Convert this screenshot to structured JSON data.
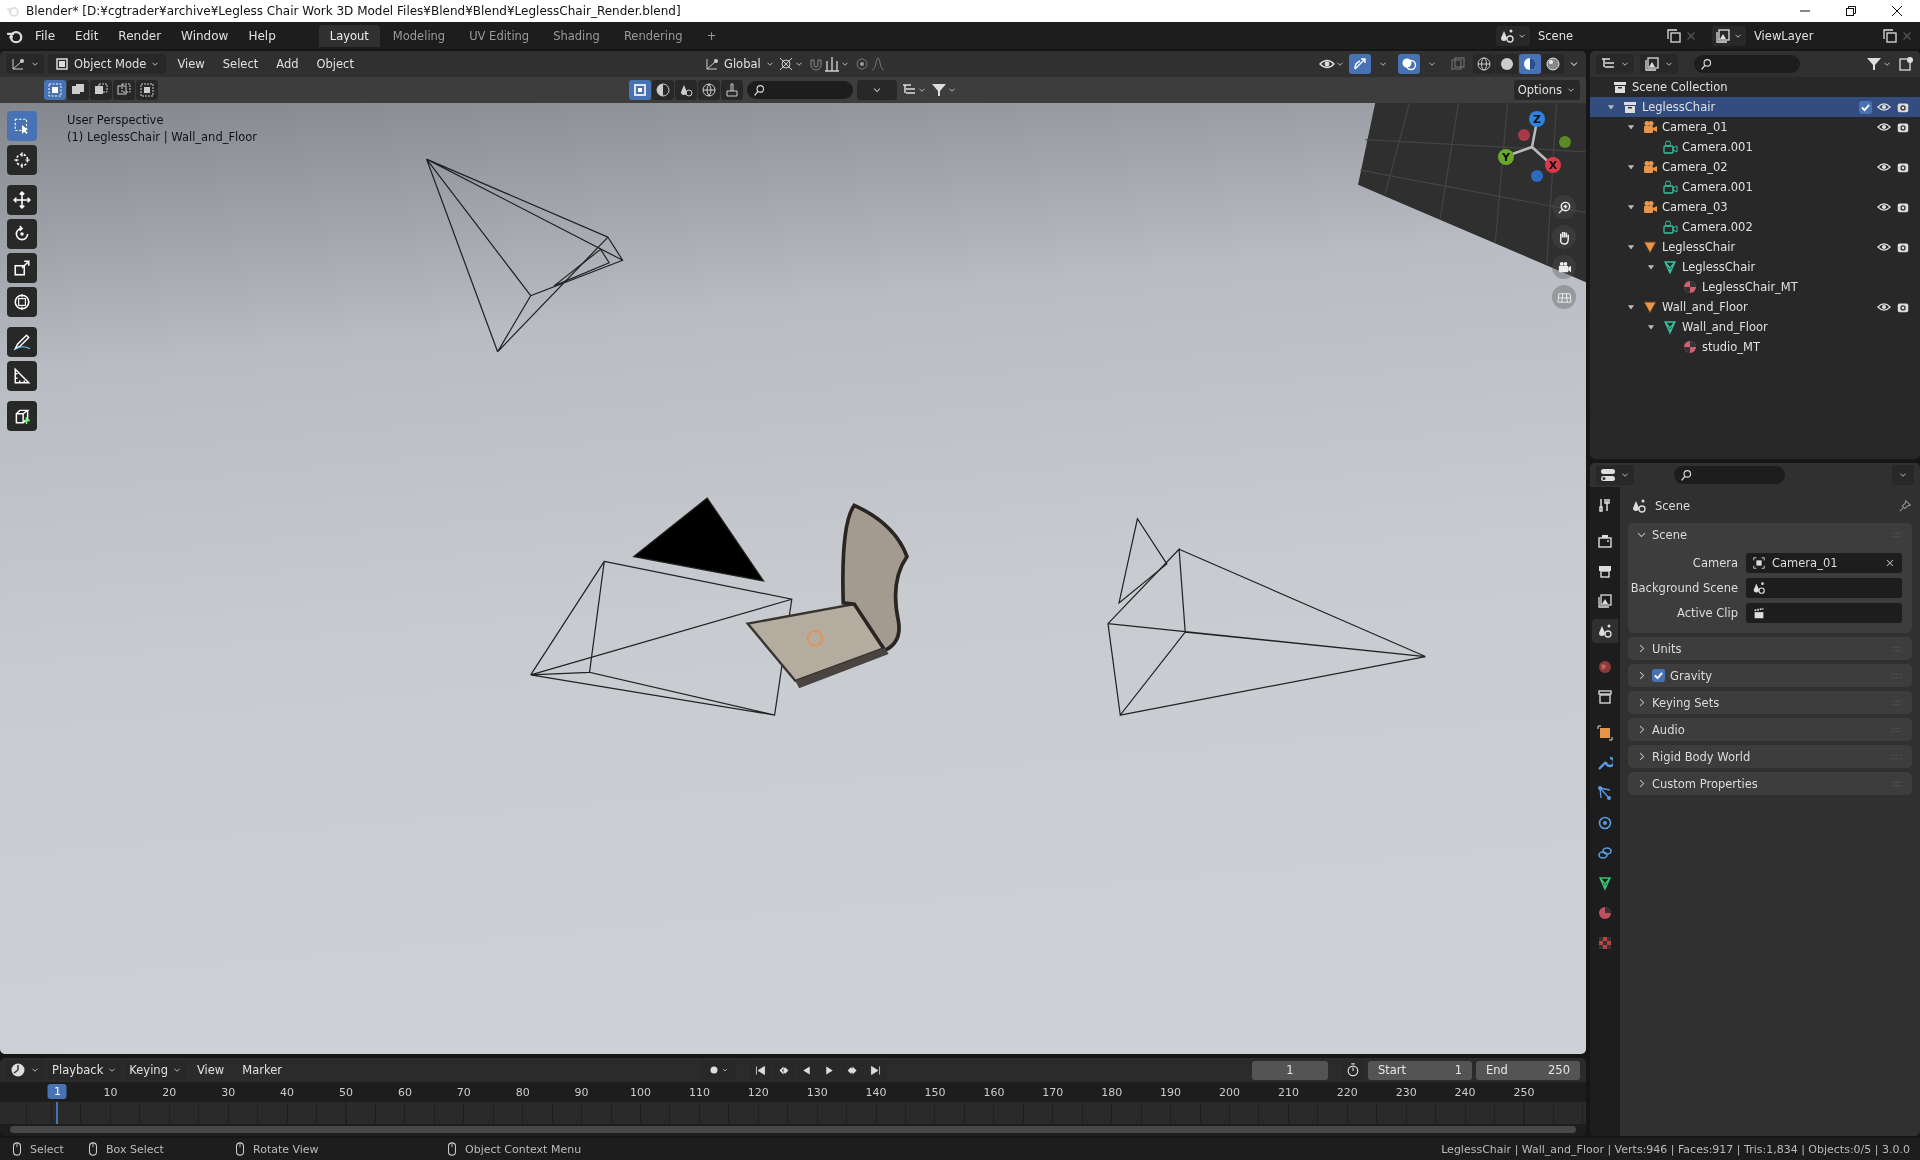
{
  "window": {
    "title": "Blender* [D:¥cgtrader¥archive¥Legless Chair Work 3D Model Files¥Blend¥Blend¥LeglessChair_Render.blend]"
  },
  "top_bar": {
    "menus": [
      "File",
      "Edit",
      "Render",
      "Window",
      "Help"
    ],
    "workspaces": [
      {
        "label": "Layout",
        "selected": true
      },
      {
        "label": "Modeling",
        "selected": false
      },
      {
        "label": "UV Editing",
        "selected": false
      },
      {
        "label": "Shading",
        "selected": false
      },
      {
        "label": "Rendering",
        "selected": false
      }
    ],
    "add_workspace": "+",
    "scene": "Scene",
    "view_layer": "ViewLayer"
  },
  "viewport": {
    "header": {
      "mode": "Object Mode",
      "menus": [
        "View",
        "Select",
        "Add",
        "Object"
      ],
      "orientation": "Global",
      "gizmos_on": true,
      "overlays_on": true,
      "shading_modes": [
        {
          "kind": "wireframe",
          "selected": false
        },
        {
          "kind": "solid",
          "selected": false
        },
        {
          "kind": "material",
          "selected": true
        },
        {
          "kind": "rendered",
          "selected": false
        }
      ]
    },
    "tool_header": {
      "select_modes": [
        {
          "kind": "set",
          "selected": true
        },
        {
          "kind": "extend",
          "selected": false
        },
        {
          "kind": "subtract",
          "selected": false
        },
        {
          "kind": "invert",
          "selected": false
        },
        {
          "kind": "intersect",
          "selected": false
        }
      ],
      "filters": [
        {
          "kind": "select",
          "selected": true
        },
        {
          "kind": "sphere",
          "selected": false
        },
        {
          "kind": "drops",
          "selected": false
        },
        {
          "kind": "globe",
          "selected": false
        },
        {
          "kind": "brush",
          "selected": false
        }
      ],
      "options": "Options"
    },
    "view_name": "User Perspective",
    "object_info": "(1) LeglessChair | Wall_and_Floor",
    "tools": [
      {
        "kind": "select-box",
        "selected": true
      },
      {
        "kind": "cursor",
        "selected": false
      },
      {
        "kind": "move",
        "selected": false
      },
      {
        "kind": "rotate",
        "selected": false
      },
      {
        "kind": "scale",
        "selected": false
      },
      {
        "kind": "transform",
        "selected": false
      },
      {
        "kind": "annotate",
        "selected": false
      },
      {
        "kind": "measure",
        "selected": false
      },
      {
        "kind": "add-cube",
        "selected": false
      }
    ],
    "gizmo": {
      "axes": [
        "X",
        "Y",
        "Z"
      ]
    }
  },
  "outliner": {
    "root": "Scene Collection",
    "tree": [
      {
        "name": "LeglessChair",
        "kind": "collection",
        "selected": true,
        "expanded": true,
        "checked": true,
        "children": [
          {
            "name": "Camera_01",
            "kind": "camera-object",
            "selected": false,
            "expanded": true,
            "children": [
              {
                "name": "Camera.001",
                "kind": "camera-data",
                "selected": false
              }
            ]
          },
          {
            "name": "Camera_02",
            "kind": "camera-object",
            "selected": false,
            "expanded": true,
            "children": [
              {
                "name": "Camera.001",
                "kind": "camera-data",
                "selected": false
              }
            ]
          },
          {
            "name": "Camera_03",
            "kind": "camera-object",
            "selected": false,
            "expanded": true,
            "children": [
              {
                "name": "Camera.002",
                "kind": "camera-data",
                "selected": false
              }
            ]
          },
          {
            "name": "LeglessChair",
            "kind": "mesh-object",
            "selected": false,
            "expanded": true,
            "children": [
              {
                "name": "LeglessChair",
                "kind": "mesh-data",
                "selected": false,
                "expanded": true,
                "children": [
                  {
                    "name": "LeglessChair_MT",
                    "kind": "material",
                    "selected": false
                  }
                ]
              }
            ]
          },
          {
            "name": "Wall_and_Floor",
            "kind": "mesh-object",
            "selected": false,
            "expanded": true,
            "children": [
              {
                "name": "Wall_and_Floor",
                "kind": "mesh-data",
                "selected": false,
                "expanded": true,
                "children": [
                  {
                    "name": "studio_MT",
                    "kind": "material",
                    "selected": false
                  }
                ]
              }
            ]
          }
        ]
      }
    ]
  },
  "properties": {
    "tabs": [
      {
        "kind": "tool",
        "selected": false
      },
      {
        "kind": "render",
        "selected": false
      },
      {
        "kind": "output",
        "selected": false
      },
      {
        "kind": "view-layer",
        "selected": false
      },
      {
        "kind": "scene",
        "selected": true
      },
      {
        "kind": "world",
        "selected": false
      },
      {
        "kind": "collection",
        "selected": false
      },
      {
        "kind": "object",
        "selected": false
      },
      {
        "kind": "modifiers",
        "selected": false
      },
      {
        "kind": "particles",
        "selected": false
      },
      {
        "kind": "physics",
        "selected": false
      },
      {
        "kind": "constraints",
        "selected": false
      },
      {
        "kind": "data",
        "selected": false
      },
      {
        "kind": "material",
        "selected": false
      },
      {
        "kind": "texture",
        "selected": false
      }
    ],
    "context": "Scene",
    "panels": [
      {
        "title": "Scene",
        "kind": "plain",
        "expanded": true,
        "fields": [
          {
            "label": "Camera",
            "kind": "camera",
            "value": "Camera_01"
          },
          {
            "label": "Background Scene",
            "kind": "scene"
          },
          {
            "label": "Active Clip",
            "kind": "clip"
          }
        ]
      },
      {
        "title": "Units",
        "kind": "plain",
        "expanded": false
      },
      {
        "title": "Gravity",
        "kind": "toggle",
        "checked": true,
        "expanded": false
      },
      {
        "title": "Keying Sets",
        "kind": "plain",
        "expanded": false
      },
      {
        "title": "Audio",
        "kind": "plain",
        "expanded": false
      },
      {
        "title": "Rigid Body World",
        "kind": "plain",
        "expanded": false
      },
      {
        "title": "Custom Properties",
        "kind": "plain",
        "expanded": false
      }
    ]
  },
  "timeline": {
    "menus": [
      {
        "label": "Playback",
        "kind": "dropdown"
      },
      {
        "label": "Keying",
        "kind": "dropdown"
      },
      {
        "label": "View",
        "kind": "menu"
      },
      {
        "label": "Marker",
        "kind": "menu"
      }
    ],
    "current_frame": "1",
    "start_label": "Start",
    "start": "1",
    "end_label": "End",
    "end": "250",
    "ruler": [
      {
        "label": "1",
        "selected": true
      },
      {
        "label": "10",
        "selected": false
      },
      {
        "label": "20",
        "selected": false
      },
      {
        "label": "30",
        "selected": false
      },
      {
        "label": "40",
        "selected": false
      },
      {
        "label": "50",
        "selected": false
      },
      {
        "label": "60",
        "selected": false
      },
      {
        "label": "70",
        "selected": false
      },
      {
        "label": "80",
        "selected": false
      },
      {
        "label": "90",
        "selected": false
      },
      {
        "label": "100",
        "selected": false
      },
      {
        "label": "110",
        "selected": false
      },
      {
        "label": "120",
        "selected": false
      },
      {
        "label": "130",
        "selected": false
      },
      {
        "label": "140",
        "selected": false
      },
      {
        "label": "150",
        "selected": false
      },
      {
        "label": "160",
        "selected": false
      },
      {
        "label": "170",
        "selected": false
      },
      {
        "label": "180",
        "selected": false
      },
      {
        "label": "190",
        "selected": false
      },
      {
        "label": "200",
        "selected": false
      },
      {
        "label": "210",
        "selected": false
      },
      {
        "label": "220",
        "selected": false
      },
      {
        "label": "230",
        "selected": false
      },
      {
        "label": "240",
        "selected": false
      },
      {
        "label": "250",
        "selected": false
      }
    ]
  },
  "status_bar": {
    "hints": [
      "Select",
      "Box Select",
      "Rotate View",
      "Object Context Menu"
    ],
    "stats": "LeglessChair | Wall_and_Floor | Verts:946 | Faces:917 | Tris:1,834 | Objects:0/5 | 3.0.0"
  }
}
